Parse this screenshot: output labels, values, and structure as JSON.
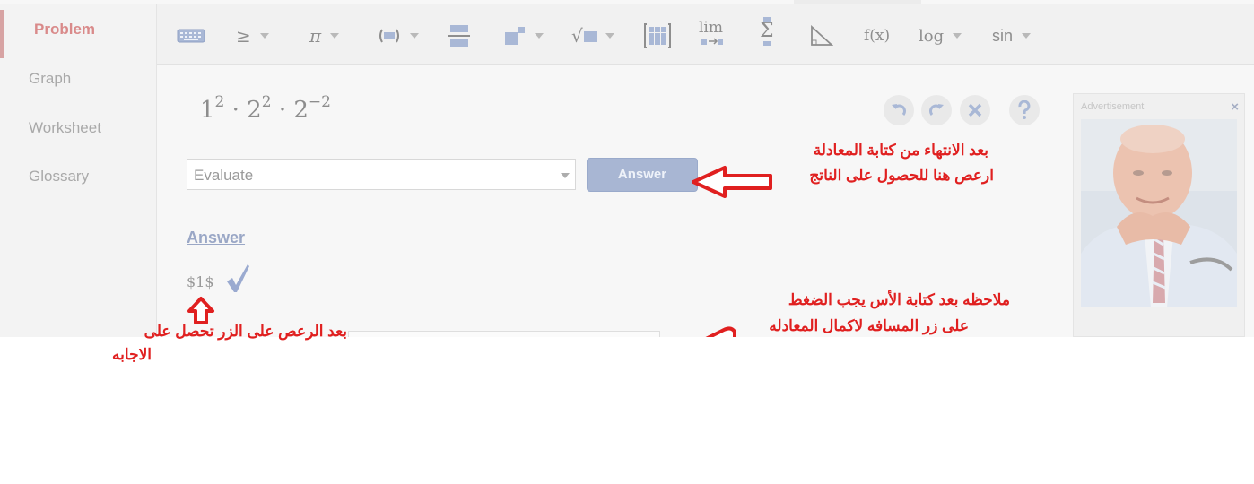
{
  "sidebar": {
    "items": [
      {
        "label": "Problem"
      },
      {
        "label": "Graph"
      },
      {
        "label": "Worksheet"
      },
      {
        "label": "Glossary"
      }
    ]
  },
  "toolbar": {
    "icons": [
      "keyboard-icon",
      "inequality-icon",
      "pi-icon",
      "parentheses-icon",
      "fraction-icon",
      "exponent-icon",
      "sqrt-icon",
      "matrix-icon",
      "limit-icon",
      "sigma-icon",
      "triangle-icon",
      "function-icon",
      "log-icon",
      "trig-icon"
    ],
    "geq": "≥",
    "pi": "π",
    "sqrt": "√",
    "lim": "lim",
    "sigma": "Σ",
    "fx": "f(x)",
    "log": "log",
    "sin": "sin"
  },
  "expression": {
    "b1": "1",
    "e1": "2",
    "b2": "2",
    "e2": "2",
    "b3": "2",
    "e3": "−2",
    "dot": "·"
  },
  "operation_select": {
    "value": "Evaluate"
  },
  "answer_button": "Answer",
  "answer_heading": "Answer",
  "result": "$1$",
  "ad": {
    "label": "Advertisement",
    "close": "×"
  },
  "annotations": {
    "top_line1": "بعد الانتهاء من كتابة المعادلة",
    "top_line2": "ارعص هنا للحصول على الناتج",
    "bottom_left_line1": "بعد الرعص على الزر تحصل على",
    "bottom_left_line2": "الاجابه",
    "right_line1": "ملاحظه بعد كتابة الأس يجب الضغط",
    "right_line2": "على زر المسافه لاكمال المعادله"
  },
  "colors": {
    "annotation": "#e02020",
    "active_tab": "#d98a8a",
    "answer_button": "#a8b6d3"
  }
}
